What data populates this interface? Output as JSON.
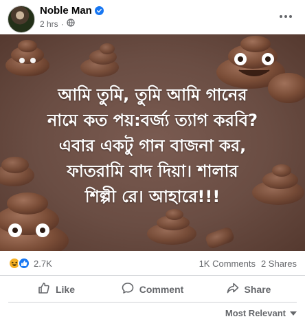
{
  "header": {
    "author": "Noble Man",
    "time": "2 hrs",
    "icons": {
      "verified": "verified-badge-icon",
      "audience": "globe-icon",
      "more": "more-options-icon"
    }
  },
  "post": {
    "caption_lines": [
      "আমি তুমি, তুমি আমি গানের",
      "নামে কত পয়:বর্জ্য ত্যাগ করবি?",
      "এবার একটু গান বাজনা কর,",
      "ফাতরামি বাদ দিয়া। শালার",
      "শিল্পী রে। আহারে!!!"
    ],
    "background_color": "#6b4e45"
  },
  "stats": {
    "reactions": "2.7K",
    "reaction_icons": [
      "haha-reaction-icon",
      "like-reaction-icon"
    ],
    "comments": "1K Comments",
    "shares": "2 Shares"
  },
  "actions": {
    "like": "Like",
    "comment": "Comment",
    "share": "Share"
  },
  "comments_sort": "Most Relevant",
  "colors": {
    "accent": "#1877f2",
    "muted_text": "#65676b",
    "haha": "#f7b125"
  }
}
